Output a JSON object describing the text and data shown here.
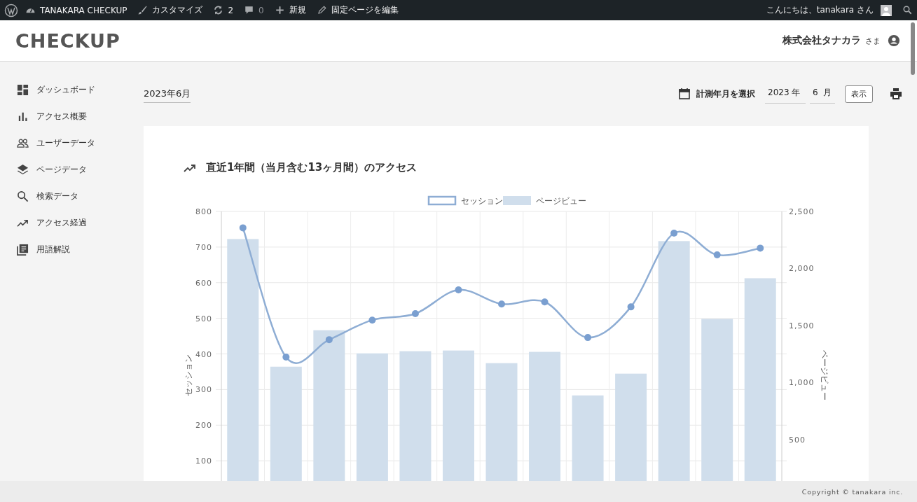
{
  "admin_bar": {
    "site_name": "TANAKARA CHECKUP",
    "customize": "カスタマイズ",
    "updates": "2",
    "comments": "0",
    "new": "新規",
    "edit_page": "固定ページを編集",
    "greeting": "こんにちは、tanakara さん"
  },
  "header": {
    "logo": "CHECKUP",
    "company": "株式会社タナカラ",
    "honorific": "さま"
  },
  "sidebar": {
    "items": [
      {
        "label": "ダッシュボード"
      },
      {
        "label": "アクセス概要"
      },
      {
        "label": "ユーザーデータ"
      },
      {
        "label": "ページデータ"
      },
      {
        "label": "検索データ"
      },
      {
        "label": "アクセス経過"
      },
      {
        "label": "用語解説"
      }
    ]
  },
  "period": "2023年6月",
  "month_picker": {
    "label": "計測年月を選択",
    "year": "2023",
    "year_unit": "年",
    "month": "6",
    "month_unit": "月",
    "button": "表示"
  },
  "card": {
    "title": "直近1年間（当月含む13ヶ月間）のアクセス",
    "chart_data": {
      "type": "bar",
      "ylabel": "セッション",
      "y2label": "ページビュー",
      "ylim": [
        0,
        800
      ],
      "y2lim": [
        0,
        2500
      ],
      "grid": true,
      "legend": "top",
      "yticks": [
        100,
        200,
        300,
        400,
        500,
        600,
        700,
        800
      ],
      "y2ticks": [
        {
          "value": 500,
          "label": "500"
        },
        {
          "value": 1000,
          "label": "1,000"
        },
        {
          "value": 1500,
          "label": "1,500"
        },
        {
          "value": 2000,
          "label": "2,000"
        },
        {
          "value": 2500,
          "label": "2,500"
        }
      ],
      "series": [
        {
          "name": "セッション",
          "type": "line",
          "marker": "circle",
          "color": "#8eadd4",
          "values": [
            754,
            391,
            440,
            495,
            513,
            580,
            540,
            546,
            446,
            532,
            739,
            678,
            697
          ]
        },
        {
          "name": "ページビュー",
          "axis": "y2",
          "color": "#d0deec",
          "values": [
            2258,
            1138,
            1458,
            1255,
            1274,
            1280,
            1169,
            1268,
            886,
            1077,
            2240,
            1557,
            1914
          ]
        }
      ]
    }
  },
  "footer": "Copyright © tanakara inc."
}
